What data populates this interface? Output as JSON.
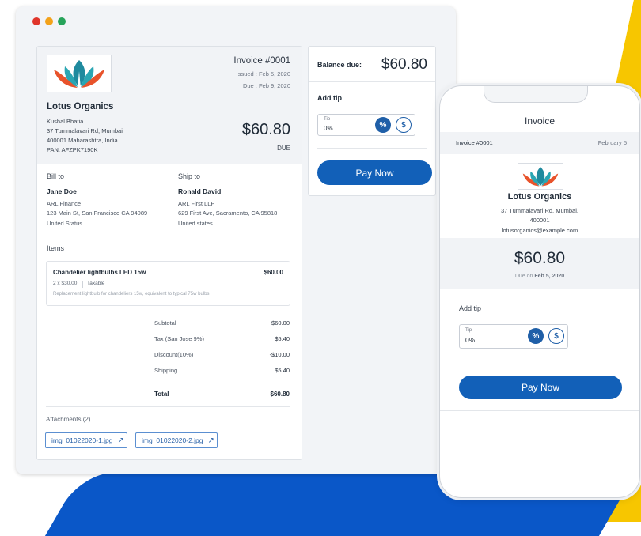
{
  "colors": {
    "accent": "#1260b8",
    "yellow": "#f7c600",
    "blue": "#0a57c8"
  },
  "window": {
    "dots": [
      "#e0352b",
      "#f3a21a",
      "#27a35a"
    ]
  },
  "invoice": {
    "number": "Invoice #0001",
    "issued": "Issued : Feb 5, 2020",
    "due": "Due : Feb 9, 2020",
    "company": "Lotus Organics",
    "sender_lines": [
      "Kushal Bhatia",
      "37 Tummalavari Rd, Mumbai",
      "400001 Maharashtra, India",
      "PAN: AFZPK7190K"
    ],
    "amount": "$60.80",
    "amount_label": "DUE",
    "bill_to": {
      "label": "Bill to",
      "name": "Jane Doe",
      "lines": [
        "ARL Finance",
        "123 Main St, San Francisco CA 94089",
        "United Status"
      ]
    },
    "ship_to": {
      "label": "Ship to",
      "name": "Ronald David",
      "lines": [
        "ARL First LLP",
        "629 First Ave, Sacramento, CA 95818",
        "United states"
      ]
    },
    "items_label": "Items",
    "item": {
      "name": "Chandelier lightbulbs LED 15w",
      "price": "$60.00",
      "qty": "2 x $30.00",
      "tax": "Taxable",
      "desc": "Replacement lightbulb for chandeliers 15w, equivalent to typical 75w bulbs"
    },
    "totals": [
      {
        "label": "Subtotal",
        "value": "$60.00"
      },
      {
        "label": "Tax (San Jose 9%)",
        "value": "$5.40"
      },
      {
        "label": "Discount(10%)",
        "value": "-$10.00"
      },
      {
        "label": "Shipping",
        "value": "$5.40"
      }
    ],
    "total": {
      "label": "Total",
      "value": "$60.80"
    },
    "attachments_label": "Attachments (2)",
    "attachments": [
      "img_01022020-1.jpg",
      "img_01022020-2.jpg"
    ]
  },
  "summary": {
    "balance_label": "Balance due:",
    "balance": "$60.80",
    "add_tip": "Add tip",
    "tip_label": "Tip",
    "tip_value": "0%",
    "pct": "%",
    "dollar": "$",
    "pay": "Pay Now"
  },
  "phone": {
    "title": "Invoice",
    "number": "Invoice #0001",
    "date": "February 5",
    "company": "Lotus Organics",
    "address1": "37 Tummalavari Rd, Mumbai,",
    "address2": "400001",
    "email": "lotusorganics@example.com",
    "amount": "$60.80",
    "due_prefix": "Due on ",
    "due_date": "Feb 5, 2020",
    "add_tip": "Add tip",
    "tip_label": "Tip",
    "tip_value": "0%",
    "pct": "%",
    "dollar": "$",
    "pay": "Pay Now"
  }
}
